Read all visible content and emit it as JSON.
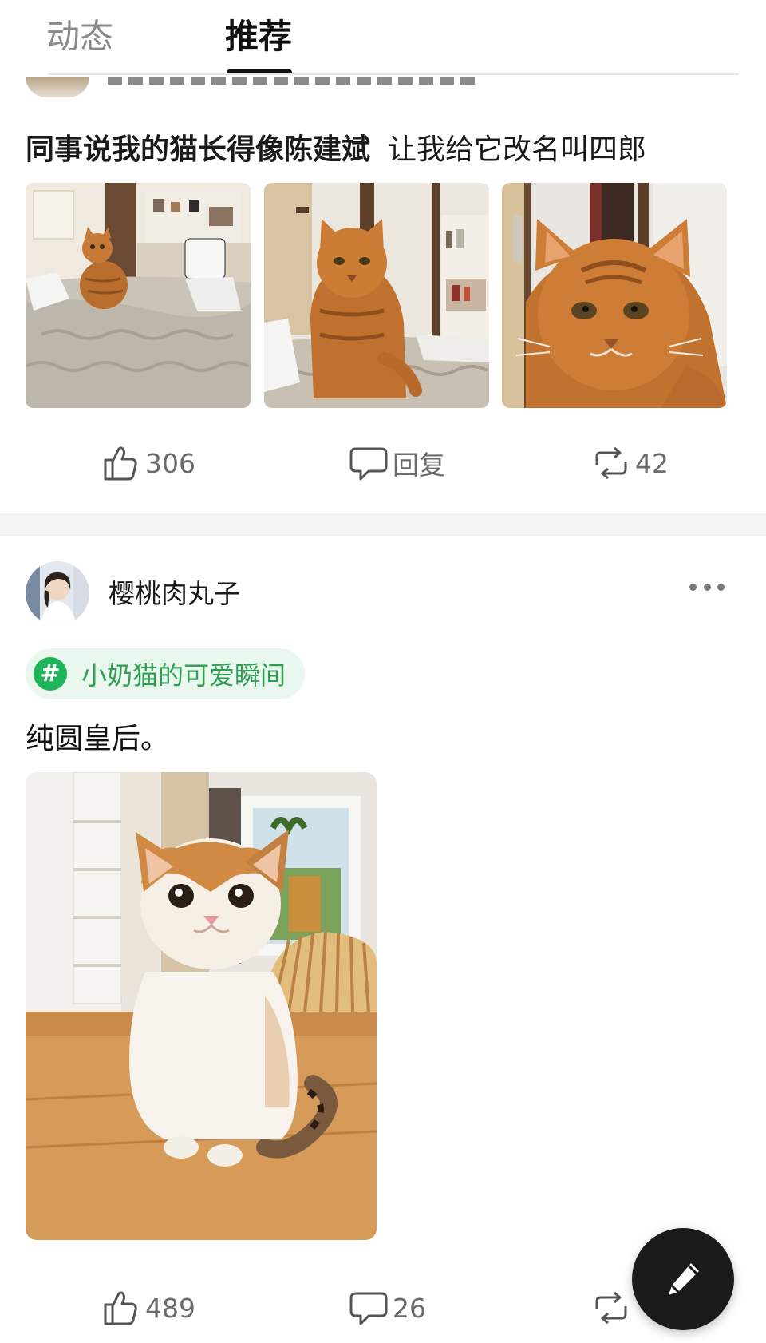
{
  "tabs": [
    {
      "label": "动态",
      "active": false
    },
    {
      "label": "推荐",
      "active": true
    }
  ],
  "post1": {
    "text_bold": "同事说我的猫长得像陈建斌",
    "text_rest": "让我给它改名叫四郎",
    "images": [
      "orange-cat-on-bed-far",
      "orange-cat-on-bed-mid",
      "orange-cat-closeup"
    ],
    "likes": "306",
    "reply_label": "回复",
    "reposts": "42"
  },
  "post2": {
    "username": "樱桃肉丸子",
    "topic": "小奶猫的可爱瞬间",
    "topic_icon": "#",
    "text": "纯圆皇后。",
    "image": "calico-kitten-on-table",
    "likes": "489",
    "replies": "26"
  },
  "icons": {
    "like": "thumbs-up-icon",
    "reply": "comment-bubble-icon",
    "repost": "repost-arrows-icon",
    "more": "more-dots-icon",
    "compose": "pen-icon"
  },
  "colors": {
    "accent_green": "#1fb35a",
    "topic_bg": "#eaf7ee",
    "topic_text": "#2f9d52",
    "fab_bg": "#1b1b1b"
  }
}
